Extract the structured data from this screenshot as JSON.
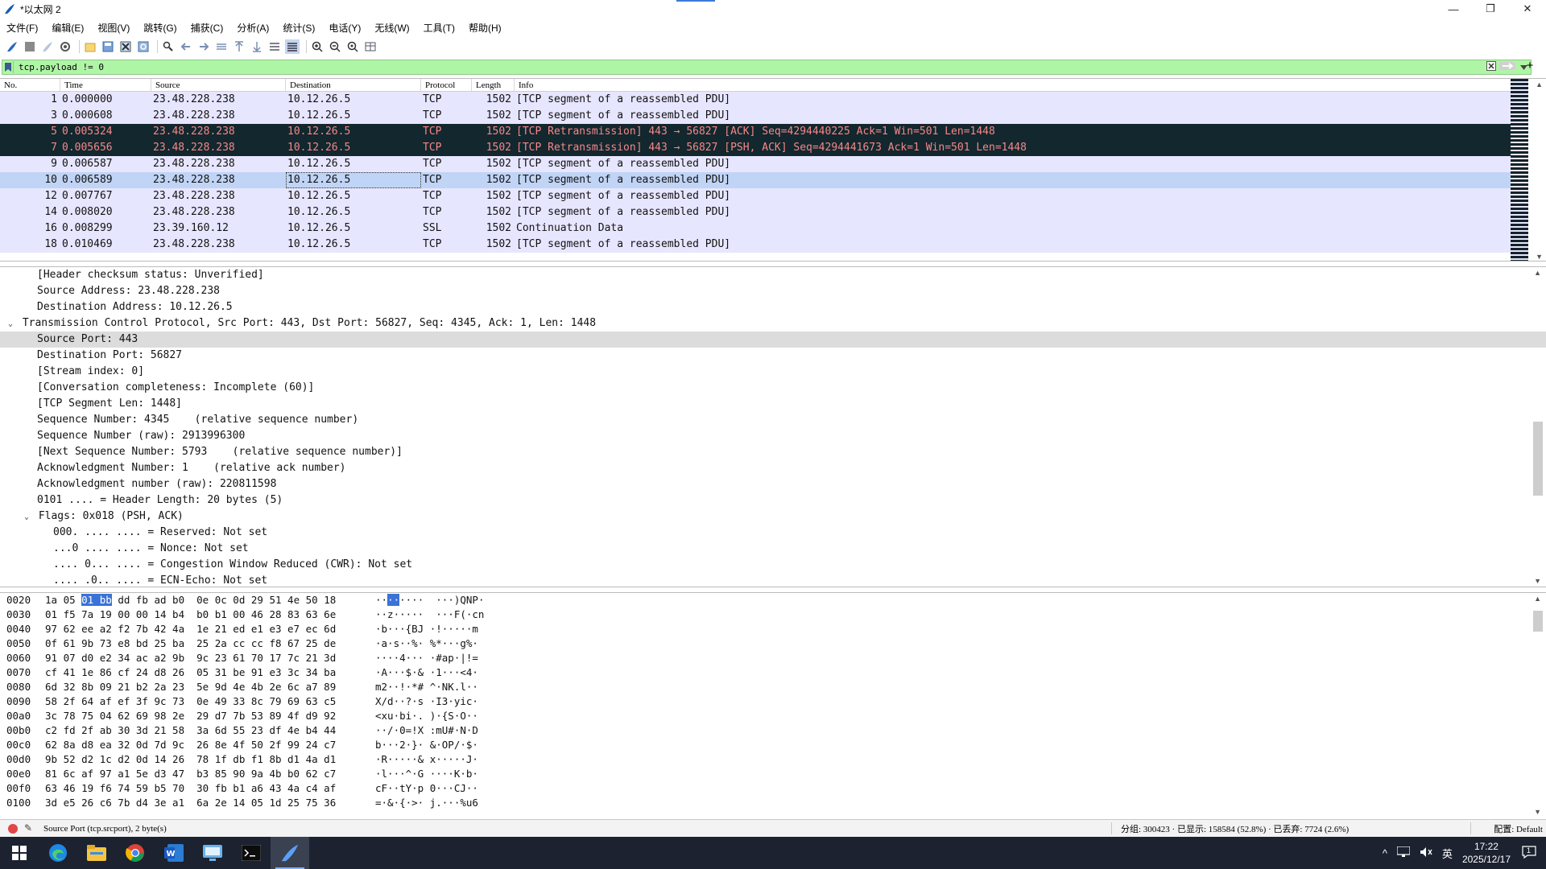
{
  "window": {
    "title": "*以太网 2",
    "minimize": "—",
    "restore": "❐",
    "close": "✕"
  },
  "menu": [
    "文件(F)",
    "编辑(E)",
    "视图(V)",
    "跳转(G)",
    "捕获(C)",
    "分析(A)",
    "统计(S)",
    "电话(Y)",
    "无线(W)",
    "工具(T)",
    "帮助(H)"
  ],
  "filter": {
    "text": "tcp.payload != 0",
    "plus": "+"
  },
  "packet_list": {
    "headers": [
      "No.",
      "Time",
      "Source",
      "Destination",
      "Protocol",
      "Length",
      "Info"
    ],
    "rows": [
      {
        "no": "1",
        "time": "0.000000",
        "src": "23.48.228.238",
        "dst": "10.12.26.5",
        "proto": "TCP",
        "len": "1502",
        "info": "[TCP segment of a reassembled PDU]",
        "style": "normal"
      },
      {
        "no": "3",
        "time": "0.000608",
        "src": "23.48.228.238",
        "dst": "10.12.26.5",
        "proto": "TCP",
        "len": "1502",
        "info": "[TCP segment of a reassembled PDU]",
        "style": "normal"
      },
      {
        "no": "5",
        "time": "0.005324",
        "src": "23.48.228.238",
        "dst": "10.12.26.5",
        "proto": "TCP",
        "len": "1502",
        "info": "[TCP Retransmission] 443 → 56827 [ACK] Seq=4294440225 Ack=1 Win=501 Len=1448",
        "style": "ret"
      },
      {
        "no": "7",
        "time": "0.005656",
        "src": "23.48.228.238",
        "dst": "10.12.26.5",
        "proto": "TCP",
        "len": "1502",
        "info": "[TCP Retransmission] 443 → 56827 [PSH, ACK] Seq=4294441673 Ack=1 Win=501 Len=1448",
        "style": "ret"
      },
      {
        "no": "9",
        "time": "0.006587",
        "src": "23.48.228.238",
        "dst": "10.12.26.5",
        "proto": "TCP",
        "len": "1502",
        "info": "[TCP segment of a reassembled PDU]",
        "style": "normal"
      },
      {
        "no": "10",
        "time": "0.006589",
        "src": "23.48.228.238",
        "dst": "10.12.26.5",
        "proto": "TCP",
        "len": "1502",
        "info": "[TCP segment of a reassembled PDU]",
        "style": "sel"
      },
      {
        "no": "12",
        "time": "0.007767",
        "src": "23.48.228.238",
        "dst": "10.12.26.5",
        "proto": "TCP",
        "len": "1502",
        "info": "[TCP segment of a reassembled PDU]",
        "style": "normal"
      },
      {
        "no": "14",
        "time": "0.008020",
        "src": "23.48.228.238",
        "dst": "10.12.26.5",
        "proto": "TCP",
        "len": "1502",
        "info": "[TCP segment of a reassembled PDU]",
        "style": "normal"
      },
      {
        "no": "16",
        "time": "0.008299",
        "src": "23.39.160.12",
        "dst": "10.12.26.5",
        "proto": "SSL",
        "len": "1502",
        "info": "Continuation Data",
        "style": "normal"
      },
      {
        "no": "18",
        "time": "0.010469",
        "src": "23.48.228.238",
        "dst": "10.12.26.5",
        "proto": "TCP",
        "len": "1502",
        "info": "[TCP segment of a reassembled PDU]",
        "style": "normal"
      }
    ]
  },
  "details": [
    {
      "indent": 2,
      "twisty": "",
      "text": "[Header checksum status: Unverified]",
      "hl": false
    },
    {
      "indent": 2,
      "twisty": "",
      "text": "Source Address: 23.48.228.238",
      "hl": false
    },
    {
      "indent": 2,
      "twisty": "",
      "text": "Destination Address: 10.12.26.5",
      "hl": false
    },
    {
      "indent": 0,
      "twisty": "v",
      "text": "Transmission Control Protocol, Src Port: 443, Dst Port: 56827, Seq: 4345, Ack: 1, Len: 1448",
      "hl": false
    },
    {
      "indent": 2,
      "twisty": "",
      "text": "Source Port: 443",
      "hl": true
    },
    {
      "indent": 2,
      "twisty": "",
      "text": "Destination Port: 56827",
      "hl": false
    },
    {
      "indent": 2,
      "twisty": "",
      "text": "[Stream index: 0]",
      "hl": false
    },
    {
      "indent": 2,
      "twisty": "",
      "text": "[Conversation completeness: Incomplete (60)]",
      "hl": false
    },
    {
      "indent": 2,
      "twisty": "",
      "text": "[TCP Segment Len: 1448]",
      "hl": false
    },
    {
      "indent": 2,
      "twisty": "",
      "text": "Sequence Number: 4345    (relative sequence number)",
      "hl": false
    },
    {
      "indent": 2,
      "twisty": "",
      "text": "Sequence Number (raw): 2913996300",
      "hl": false
    },
    {
      "indent": 2,
      "twisty": "",
      "text": "[Next Sequence Number: 5793    (relative sequence number)]",
      "hl": false
    },
    {
      "indent": 2,
      "twisty": "",
      "text": "Acknowledgment Number: 1    (relative ack number)",
      "hl": false
    },
    {
      "indent": 2,
      "twisty": "",
      "text": "Acknowledgment number (raw): 220811598",
      "hl": false
    },
    {
      "indent": 2,
      "twisty": "",
      "text": "0101 .... = Header Length: 20 bytes (5)",
      "hl": false
    },
    {
      "indent": 1,
      "twisty": "v",
      "text": "Flags: 0x018 (PSH, ACK)",
      "hl": false
    },
    {
      "indent": 3,
      "twisty": "",
      "text": "000. .... .... = Reserved: Not set",
      "hl": false
    },
    {
      "indent": 3,
      "twisty": "",
      "text": "...0 .... .... = Nonce: Not set",
      "hl": false
    },
    {
      "indent": 3,
      "twisty": "",
      "text": ".... 0... .... = Congestion Window Reduced (CWR): Not set",
      "hl": false
    },
    {
      "indent": 3,
      "twisty": "",
      "text": ".... .0.. .... = ECN-Echo: Not set",
      "hl": false
    }
  ],
  "bytes": [
    {
      "off": "0020",
      "hex": [
        "1a 05 ",
        "01 bb",
        " dd fb ad b0  0e 0c 0d 29 51 4e 50 18"
      ],
      "asc": [
        "··",
        "··",
        "····  ···)QNP·"
      ]
    },
    {
      "off": "0030",
      "hex": [
        "01 f5 7a 19 00 00 14 b4  b0 b1 00 46 28 83 63 6e"
      ],
      "asc": [
        "··z·····  ···F(·cn"
      ]
    },
    {
      "off": "0040",
      "hex": [
        "97 62 ee a2 f2 7b 42 4a  1e 21 ed e1 e3 e7 ec 6d"
      ],
      "asc": [
        "·b···{BJ ·!·····m"
      ]
    },
    {
      "off": "0050",
      "hex": [
        "0f 61 9b 73 e8 bd 25 ba  25 2a cc cc f8 67 25 de"
      ],
      "asc": [
        "·a·s··%· %*···g%·"
      ]
    },
    {
      "off": "0060",
      "hex": [
        "91 07 d0 e2 34 ac a2 9b  9c 23 61 70 17 7c 21 3d"
      ],
      "asc": [
        "····4··· ·#ap·|!="
      ]
    },
    {
      "off": "0070",
      "hex": [
        "cf 41 1e 86 cf 24 d8 26  05 31 be 91 e3 3c 34 ba"
      ],
      "asc": [
        "·A···$·& ·1···<4·"
      ]
    },
    {
      "off": "0080",
      "hex": [
        "6d 32 8b 09 21 b2 2a 23  5e 9d 4e 4b 2e 6c a7 89"
      ],
      "asc": [
        "m2··!·*# ^·NK.l··"
      ]
    },
    {
      "off": "0090",
      "hex": [
        "58 2f 64 af ef 3f 9c 73  0e 49 33 8c 79 69 63 c5"
      ],
      "asc": [
        "X/d··?·s ·I3·yic·"
      ]
    },
    {
      "off": "00a0",
      "hex": [
        "3c 78 75 04 62 69 98 2e  29 d7 7b 53 89 4f d9 92"
      ],
      "asc": [
        "<xu·bi·. )·{S·O··"
      ]
    },
    {
      "off": "00b0",
      "hex": [
        "c2 fd 2f ab 30 3d 21 58  3a 6d 55 23 df 4e b4 44"
      ],
      "asc": [
        "··/·0=!X :mU#·N·D"
      ]
    },
    {
      "off": "00c0",
      "hex": [
        "62 8a d8 ea 32 0d 7d 9c  26 8e 4f 50 2f 99 24 c7"
      ],
      "asc": [
        "b···2·}· &·OP/·$·"
      ]
    },
    {
      "off": "00d0",
      "hex": [
        "9b 52 d2 1c d2 0d 14 26  78 1f db f1 8b d1 4a d1"
      ],
      "asc": [
        "·R·····& x·····J·"
      ]
    },
    {
      "off": "00e0",
      "hex": [
        "81 6c af 97 a1 5e d3 47  b3 85 90 9a 4b b0 62 c7"
      ],
      "asc": [
        "·l···^·G ····K·b·"
      ]
    },
    {
      "off": "00f0",
      "hex": [
        "63 46 19 f6 74 59 b5 70  30 fb b1 a6 43 4a c4 af"
      ],
      "asc": [
        "cF··tY·p 0···CJ··"
      ]
    },
    {
      "off": "0100",
      "hex": [
        "3d e5 26 c6 7b d4 3e a1  6a 2e 14 05 1d 25 75 36"
      ],
      "asc": [
        "=·&·{·>· j.···%u6"
      ]
    }
  ],
  "status": {
    "field": "Source Port (tcp.srcport), 2 byte(s)",
    "stats": "分组: 300423 · 已显示: 158584 (52.8%) · 已丢弃: 7724 (2.6%)",
    "profile": "配置: Default"
  },
  "taskbar": {
    "tray_caret": "^",
    "ime": "英",
    "time": "17:22",
    "date": "2025/12/17",
    "notif": "1"
  },
  "colors": {
    "filter_ok": "#aff5a6",
    "tcp_row": "#e7e6ff",
    "retrans_bg": "#12272e",
    "retrans_fg": "#f78787",
    "selected_row": "#c0d4f5"
  }
}
